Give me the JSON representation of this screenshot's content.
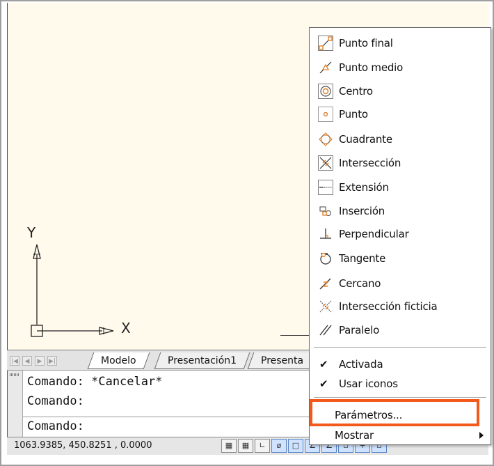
{
  "axes": {
    "y_label": "Y",
    "x_label": "X"
  },
  "tabs": [
    {
      "label": "Modelo",
      "active": true
    },
    {
      "label": "Presentación1",
      "active": false
    },
    {
      "label": "Presenta",
      "active": false
    }
  ],
  "command_line": {
    "history": [
      "Comando: *Cancelar*",
      "Comando:"
    ],
    "prompt": "Comando:"
  },
  "status_bar": {
    "coordinates": "1063.9385, 450.8251 , 0.0000"
  },
  "osnap_menu": {
    "items": [
      {
        "label": "Punto final",
        "icon": "endpoint-icon"
      },
      {
        "label": "Punto medio",
        "icon": "midpoint-icon"
      },
      {
        "label": "Centro",
        "icon": "center-icon"
      },
      {
        "label": "Punto",
        "icon": "node-icon"
      },
      {
        "label": "Cuadrante",
        "icon": "quadrant-icon"
      },
      {
        "label": "Intersección",
        "icon": "intersection-icon"
      },
      {
        "label": "Extensión",
        "icon": "extension-icon"
      },
      {
        "label": "Inserción",
        "icon": "insertion-icon"
      },
      {
        "label": "Perpendicular",
        "icon": "perpendicular-icon"
      },
      {
        "label": "Tangente",
        "icon": "tangent-icon"
      },
      {
        "label": "Cercano",
        "icon": "nearest-icon"
      },
      {
        "label": "Intersección ficticia",
        "icon": "apparent-intersection-icon"
      },
      {
        "label": "Paralelo",
        "icon": "parallel-icon"
      }
    ],
    "toggles": [
      {
        "label": "Activada",
        "checked": true
      },
      {
        "label": "Usar iconos",
        "checked": true
      }
    ],
    "settings_label": "Parámetros...",
    "display_label": "Mostrar"
  },
  "colors": {
    "highlight": "#f15a1a",
    "canvas": "#fffaec",
    "snap_marker": "#e0802a"
  }
}
